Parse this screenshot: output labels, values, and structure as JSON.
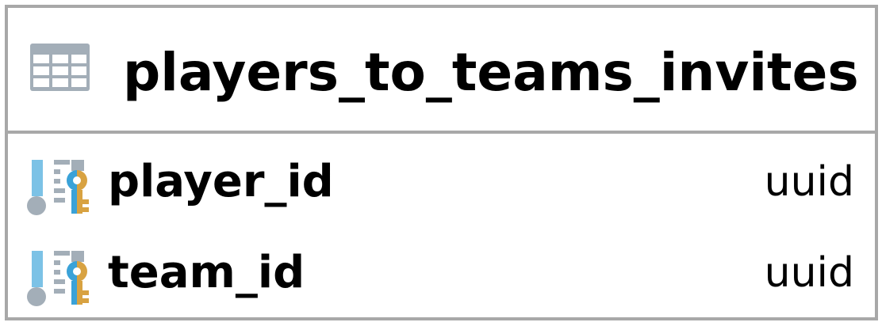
{
  "table": {
    "name": "players_to_teams_invites",
    "icon": "table-grid-icon"
  },
  "columns": [
    {
      "name": "player_id",
      "type": "uuid",
      "icon": "primary-foreign-key-column-icon"
    },
    {
      "name": "team_id",
      "type": "uuid",
      "icon": "primary-foreign-key-column-icon"
    }
  ],
  "colors": {
    "border": "#a8a8a8",
    "table_icon": "#a3aeb8",
    "column_bar": "#7cc2e6",
    "column_circle": "#a3aeb8",
    "key_blue": "#3aa2d8",
    "key_gold": "#d8a241"
  }
}
